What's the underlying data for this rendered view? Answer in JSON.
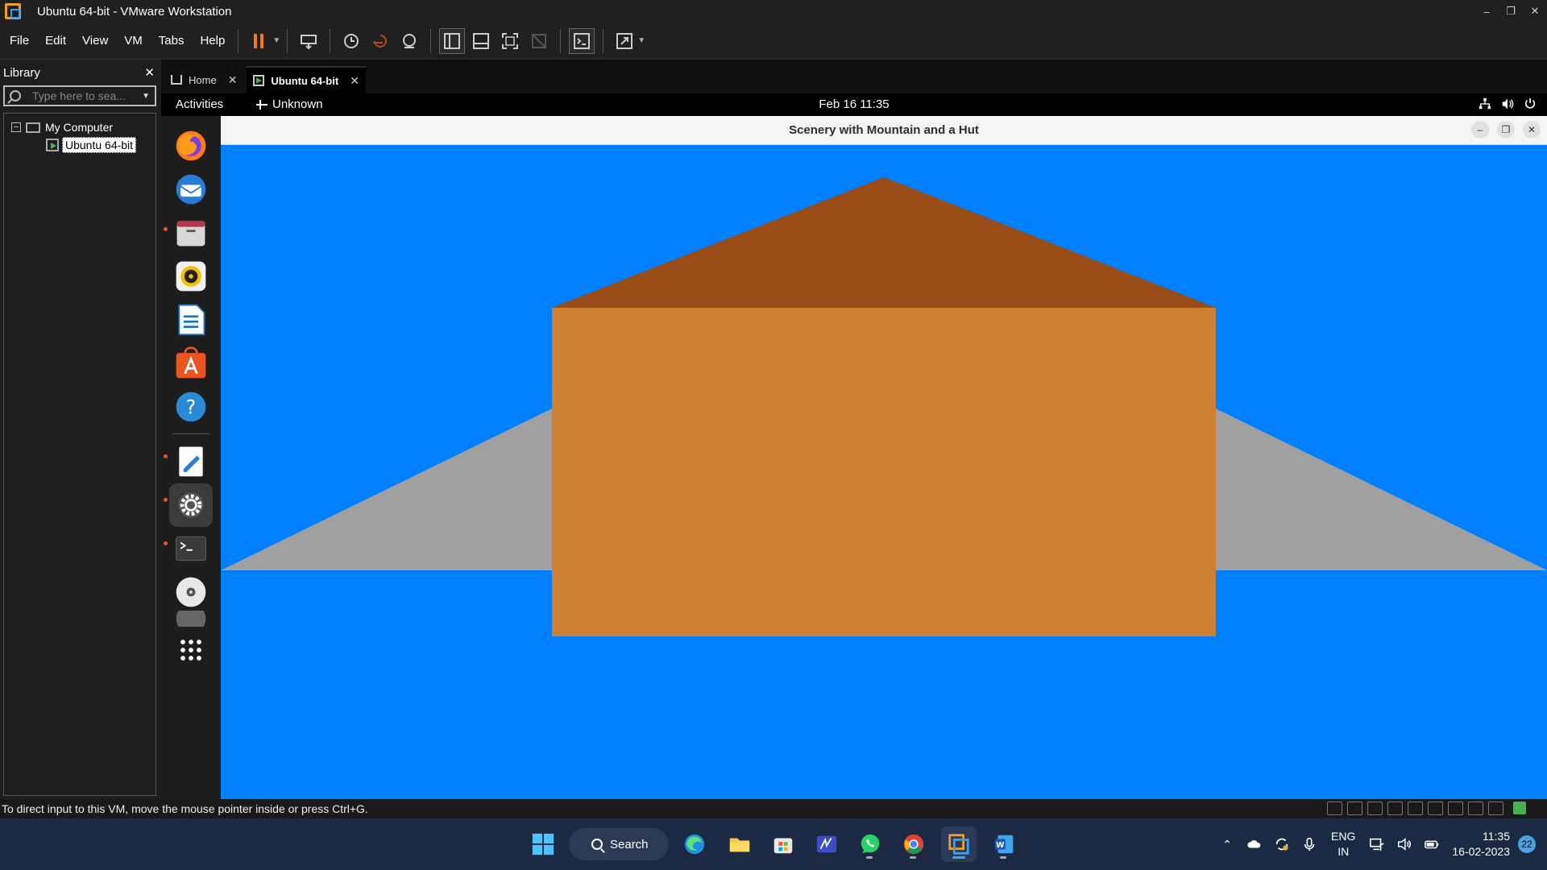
{
  "window": {
    "title": "Ubuntu 64-bit - VMware Workstation"
  },
  "menu": [
    "File",
    "Edit",
    "View",
    "VM",
    "Tabs",
    "Help"
  ],
  "library": {
    "title": "Library",
    "search_placeholder": "Type here to sea...",
    "tree": {
      "root": "My Computer",
      "child": "Ubuntu 64-bit"
    }
  },
  "tabs": [
    {
      "label": "Home"
    },
    {
      "label": "Ubuntu 64-bit"
    }
  ],
  "ubuntu": {
    "activities": "Activities",
    "network": "Unknown",
    "clock": "Feb 16  11:35"
  },
  "app_window": {
    "title": "Scenery with Mountain and a Hut"
  },
  "scene": {
    "sky_color": "#0080ff",
    "mountain_color": "#a0a0a0",
    "roof_color": "#9a4c17",
    "hut_color": "#cd7f33"
  },
  "statusbar": {
    "message": "To direct input to this VM, move the mouse pointer inside or press Ctrl+G."
  },
  "taskbar": {
    "search_label": "Search",
    "lang_top": "ENG",
    "lang_bottom": "IN",
    "time": "11:35",
    "date": "16-02-2023",
    "notifications": "22"
  }
}
